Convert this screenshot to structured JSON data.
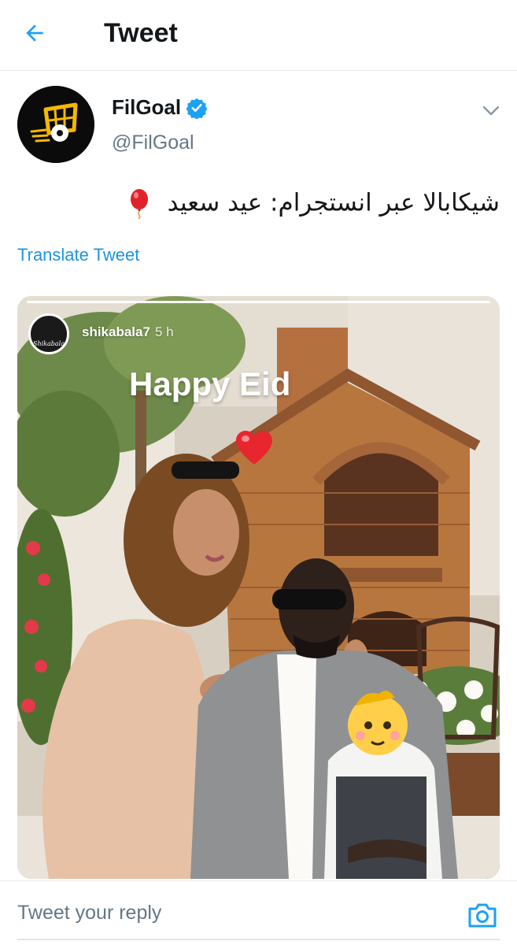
{
  "header": {
    "title": "Tweet",
    "back_icon": "arrow-left-icon"
  },
  "tweet": {
    "author_name": "FilGoal",
    "author_handle": "@FilGoal",
    "verified": true,
    "text": "شيكابالا عبر انستجرام: عيد سعيد",
    "emoji": "balloon",
    "translate_label": "Translate Tweet"
  },
  "media": {
    "story_user": "shikabala7",
    "story_time": "5 h",
    "story_avatar_text": "Shikabala",
    "caption": "Happy Eid",
    "sticker": "heart"
  },
  "reply": {
    "placeholder": "Tweet your reply",
    "camera_icon": "camera-icon"
  },
  "colors": {
    "link": "#1b95e0",
    "verified": "#1da1f2",
    "muted": "#657786"
  }
}
